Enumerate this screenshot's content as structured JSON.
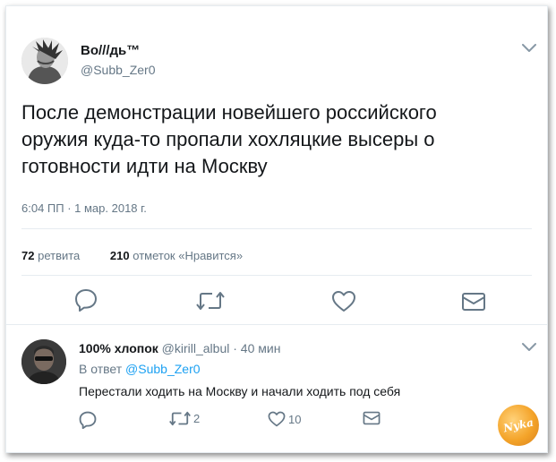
{
  "tweet": {
    "author_name": "Во///дь™",
    "author_handle": "@Subb_Zer0",
    "text": "После демонстрации новейшего российского оружия куда-то пропали хохляцкие высеры о готовности идти на Москву",
    "timestamp": "6:04 ПП · 1 мар. 2018 г.",
    "retweets_count": "72",
    "retweets_label": "ретвита",
    "likes_count": "210",
    "likes_label": "отметок «Нравится»",
    "actions": [
      "reply-icon",
      "retweet-icon",
      "heart-icon",
      "message-icon"
    ]
  },
  "reply": {
    "author_name": "100% хлопок",
    "author_handle": "@kirill_albul",
    "separator": "·",
    "time": "40 мин",
    "reply_to_prefix": "В ответ",
    "reply_to_handle": "@Subb_Zer0",
    "text": "Перестали ходить на Москву и начали ходить под себя",
    "retweets": "2",
    "likes": "10"
  },
  "watermark": {
    "text": "Nyka"
  },
  "colors": {
    "accent": "#1da1f2",
    "secondary_text": "#657786",
    "primary_text": "#14171a",
    "icon": "#657786"
  }
}
